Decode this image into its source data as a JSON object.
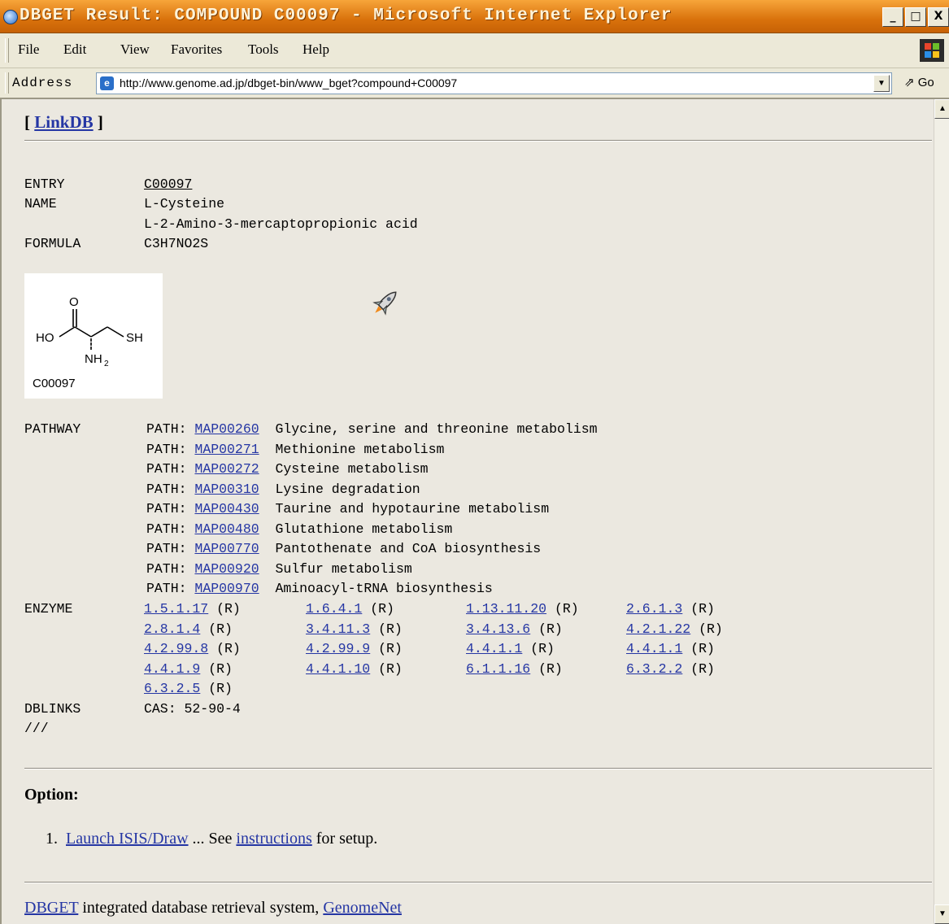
{
  "window": {
    "title": "DBGET Result: COMPOUND C00097 - Microsoft Internet Explorer",
    "buttons": [
      "_",
      "□",
      "X"
    ]
  },
  "menu": [
    {
      "label": "File"
    },
    {
      "label": "Edit"
    },
    {
      "label": "View"
    },
    {
      "label": "Favorites"
    },
    {
      "label": "Tools"
    },
    {
      "label": "Help"
    }
  ],
  "address": {
    "label": "Address",
    "url": "http://www.genome.ad.jp/dbget-bin/www_bget?compound+C00097",
    "go": "Go"
  },
  "page": {
    "linkdb_open": "[ ",
    "linkdb": "LinkDB",
    "linkdb_close": " ]",
    "entry_label": "ENTRY",
    "entry": "C00097",
    "name_label": "NAME",
    "names": [
      "L-Cysteine",
      "L-2-Amino-3-mercaptopropionic acid"
    ],
    "formula_label": "FORMULA",
    "formula": "C3H7NO2S",
    "structure": {
      "label": "C00097",
      "atoms": {
        "o": "O",
        "ho": "HO",
        "sh": "SH",
        "nh": "NH",
        "sub2": "2"
      }
    },
    "pathway_label": "PATHWAY",
    "path_prefix": "PATH:",
    "pathways": [
      {
        "id": "MAP00260",
        "name": "Glycine, serine and threonine metabolism"
      },
      {
        "id": "MAP00271",
        "name": "Methionine metabolism"
      },
      {
        "id": "MAP00272",
        "name": "Cysteine metabolism"
      },
      {
        "id": "MAP00310",
        "name": "Lysine degradation"
      },
      {
        "id": "MAP00430",
        "name": "Taurine and hypotaurine metabolism"
      },
      {
        "id": "MAP00480",
        "name": "Glutathione metabolism"
      },
      {
        "id": "MAP00770",
        "name": "Pantothenate and CoA biosynthesis"
      },
      {
        "id": "MAP00920",
        "name": "Sulfur metabolism"
      },
      {
        "id": "MAP00970",
        "name": "Aminoacyl-tRNA biosynthesis"
      }
    ],
    "enzyme_label": "ENZYME",
    "enzyme_suffix": "(R)",
    "enzymes": [
      [
        "1.5.1.17",
        "1.6.4.1",
        "1.13.11.20",
        "2.6.1.3"
      ],
      [
        "2.8.1.4",
        "3.4.11.3",
        "3.4.13.6",
        "4.2.1.22"
      ],
      [
        "4.2.99.8",
        "4.2.99.9",
        "4.4.1.1",
        "4.4.1.1"
      ],
      [
        "4.4.1.9",
        "4.4.1.10",
        "6.1.1.16",
        "6.3.2.2"
      ],
      [
        "6.3.2.5"
      ]
    ],
    "dblinks_label": "DBLINKS",
    "dblinks": "CAS: 52-90-4",
    "terminator": "///",
    "option_heading": "Option:",
    "option_num": "1.",
    "option_link": "Launch ISIS/Draw",
    "option_mid": " ... See ",
    "option_link2": "instructions",
    "option_end": " for setup.",
    "footer_link": "DBGET",
    "footer_mid": " integrated database retrieval system, ",
    "footer_link2": "GenomeNet"
  }
}
